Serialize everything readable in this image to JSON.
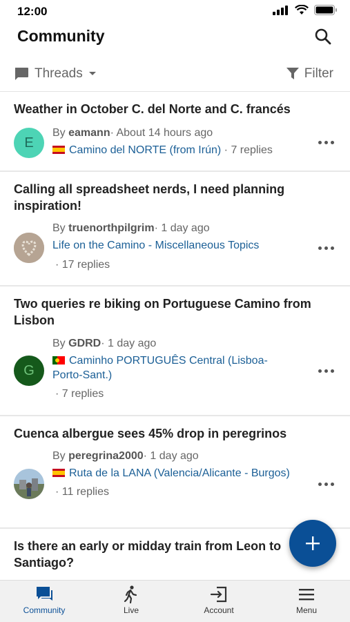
{
  "status": {
    "time": "12:00"
  },
  "header": {
    "title": "Community"
  },
  "toolbar": {
    "threads_label": "Threads",
    "filter_label": "Filter"
  },
  "threads": [
    {
      "title": "Weather in October C. del Norte and C. francés",
      "avatar_letter": "E",
      "avatar_color": "#4dd4b5",
      "author": "eamann",
      "time": "About 14 hours ago",
      "category": "Camino del NORTE (from Irún)",
      "flag": "es",
      "replies": "7 replies"
    },
    {
      "title": "Calling all spreadsheet nerds, I need planning inspiration!",
      "author": "truenorthpilgrim",
      "time": "1 day ago",
      "category": "Life on the Camino - Miscellaneous Topics",
      "replies": "17 replies"
    },
    {
      "title": "Two queries re biking on Portuguese Camino from Lisbon",
      "avatar_letter": "G",
      "avatar_color": "#15591b",
      "author": "GDRD",
      "time": "1 day ago",
      "category": "Caminho PORTUGUÊS Central (Lisboa-Porto-Sant.)",
      "flag": "pt",
      "replies": "7 replies"
    },
    {
      "title": "Cuenca albergue sees 45% drop in peregrinos",
      "author": "peregrina2000",
      "time": "1 day ago",
      "category": "Ruta de la LANA (Valencia/Alicante - Burgos)",
      "flag": "es",
      "replies": "11 replies"
    },
    {
      "title": "Is there an early or midday train from Leon to Santiago?"
    }
  ],
  "nav": [
    {
      "label": "Community",
      "icon": "chat-bubble-icon"
    },
    {
      "label": "Live",
      "icon": "walking-person-icon"
    },
    {
      "label": "Account",
      "icon": "login-icon"
    },
    {
      "label": "Menu",
      "icon": "hamburger-icon"
    }
  ],
  "by_prefix": "By ",
  "sep": "·",
  "colors": {
    "accent": "#0a4f96",
    "link": "#1b5f96"
  }
}
